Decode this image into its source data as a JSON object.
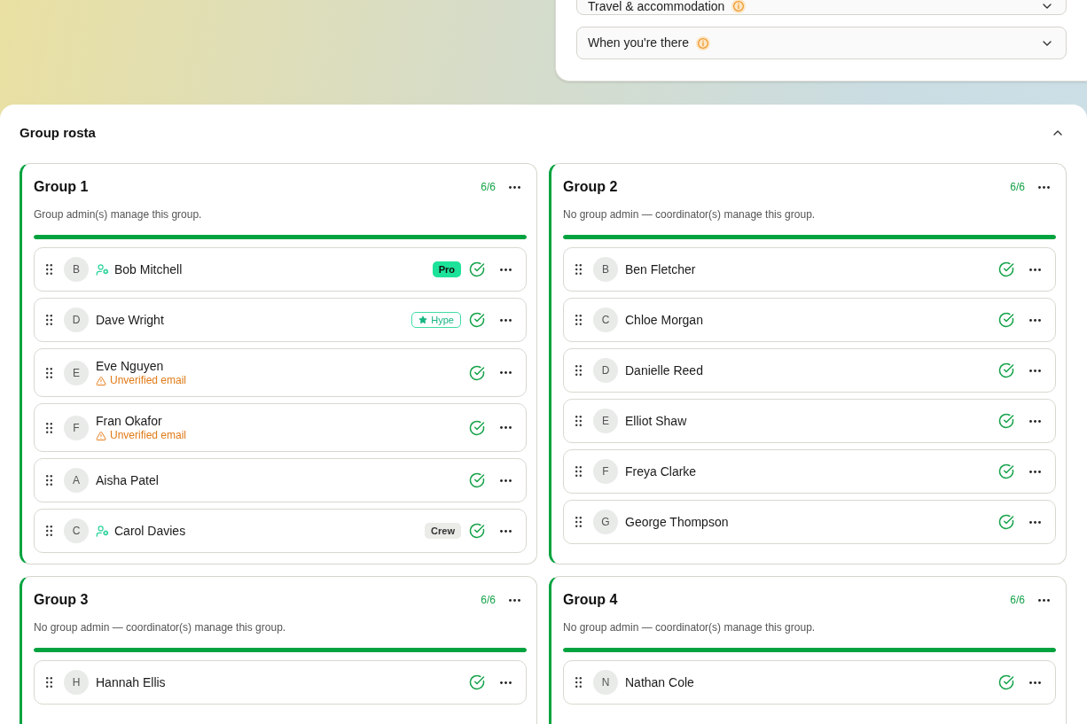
{
  "trip_sections": [
    {
      "label": "Travel & accommodation",
      "info": true,
      "expanded": false
    },
    {
      "label": "When you're there",
      "info": true,
      "expanded": false
    }
  ],
  "roster": {
    "title": "Group rosta",
    "expanded": true,
    "groups": [
      {
        "name": "Group 1",
        "count": "6/6",
        "note": "Group admin(s) manage this group.",
        "level": 1,
        "members": [
          {
            "initial": "B",
            "name": "Bob Mitchell",
            "admin": true,
            "badge": {
              "kind": "solid",
              "label": "Pro"
            },
            "verified": true
          },
          {
            "initial": "D",
            "name": "Dave Wright",
            "admin": false,
            "badge": {
              "kind": "featured",
              "label": "Hype"
            },
            "verified": true
          },
          {
            "initial": "E",
            "name": "Eve Nguyen",
            "admin": false,
            "warning": "Unverified email",
            "verified": true
          },
          {
            "initial": "F",
            "name": "Fran Okafor",
            "admin": false,
            "warning": "Unverified email",
            "verified": true
          },
          {
            "initial": "A",
            "name": "Aisha Patel",
            "admin": false,
            "verified": true
          },
          {
            "initial": "C",
            "name": "Carol Davies",
            "admin": true,
            "badge": {
              "kind": "muted",
              "label": "Crew"
            },
            "verified": true
          }
        ]
      },
      {
        "name": "Group 2",
        "count": "6/6",
        "note": "No group admin — coordinator(s) manage this group.",
        "level": 1,
        "members": [
          {
            "initial": "B",
            "name": "Ben Fletcher",
            "admin": false,
            "verified": true
          },
          {
            "initial": "C",
            "name": "Chloe Morgan",
            "admin": false,
            "verified": true
          },
          {
            "initial": "D",
            "name": "Danielle Reed",
            "admin": false,
            "verified": true
          },
          {
            "initial": "E",
            "name": "Elliot Shaw",
            "admin": false,
            "verified": true
          },
          {
            "initial": "F",
            "name": "Freya Clarke",
            "admin": false,
            "verified": true
          },
          {
            "initial": "G",
            "name": "George Thompson",
            "admin": false,
            "verified": true
          }
        ]
      },
      {
        "name": "Group 3",
        "count": "6/6",
        "note": "No group admin — coordinator(s) manage this group.",
        "level": 1,
        "members": [
          {
            "initial": "H",
            "name": "Hannah Ellis",
            "admin": false,
            "verified": true
          }
        ]
      },
      {
        "name": "Group 4",
        "count": "6/6",
        "note": "No group admin — coordinator(s) manage this group.",
        "level": 1,
        "members": [
          {
            "initial": "N",
            "name": "Nathan Cole",
            "admin": false,
            "verified": true
          }
        ]
      }
    ]
  }
}
